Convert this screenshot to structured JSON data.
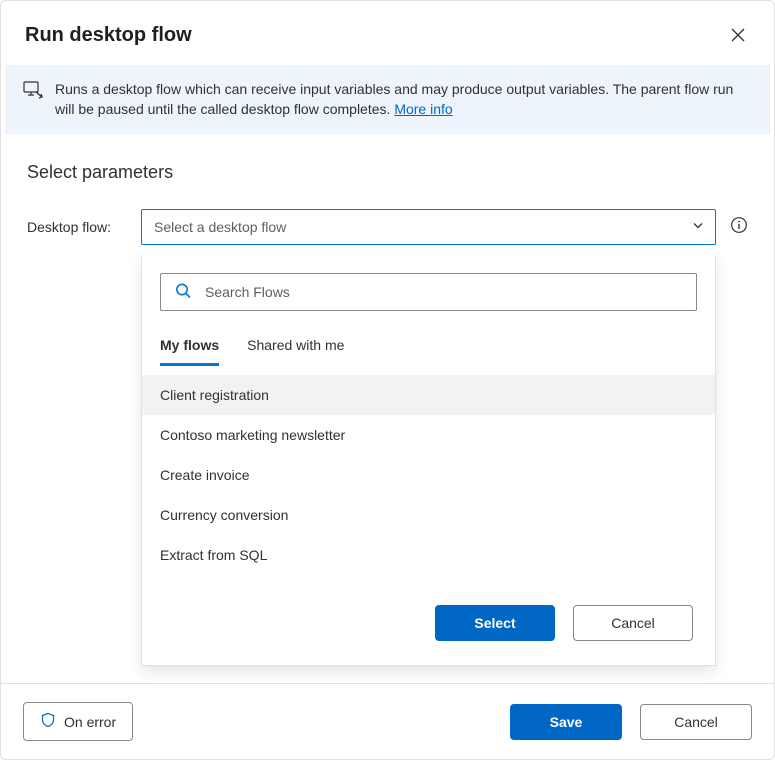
{
  "header": {
    "title": "Run desktop flow"
  },
  "banner": {
    "text": "Runs a desktop flow which can receive input variables and may produce output variables. The parent flow run will be paused until the called desktop flow completes. ",
    "link_label": "More info"
  },
  "section": {
    "title": "Select parameters",
    "field_label": "Desktop flow:",
    "placeholder": "Select a desktop flow"
  },
  "dropdown": {
    "search_placeholder": "Search Flows",
    "tabs": {
      "my_flows": "My flows",
      "shared": "Shared with me"
    },
    "items": [
      "Client registration",
      "Contoso marketing newsletter",
      "Create invoice",
      "Currency conversion",
      "Extract from SQL"
    ],
    "select_label": "Select",
    "cancel_label": "Cancel"
  },
  "footer": {
    "on_error_label": "On error",
    "save_label": "Save",
    "cancel_label": "Cancel"
  }
}
